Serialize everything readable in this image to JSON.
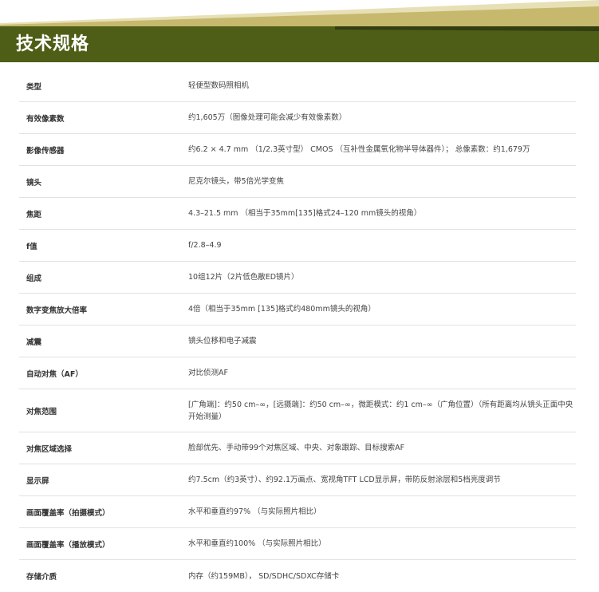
{
  "header": {
    "title": "技术规格",
    "colors": {
      "bar": "#4e5e17",
      "stripe_gold": "#c6b96e",
      "stripe_light": "#e7e0b6",
      "stripe_dark": "#323d10"
    }
  },
  "specs": [
    {
      "label": "类型",
      "value": "轻便型数码照相机"
    },
    {
      "label": "有效像素数",
      "value": "约1,605万（图像处理可能会减少有效像素数）"
    },
    {
      "label": "影像传感器",
      "value": "约6.2 × 4.7 mm （1/2.3英寸型） CMOS （互补性金属氧化物半导体器件）； 总像素数：约1,679万"
    },
    {
      "label": "镜头",
      "value": "尼克尔镜头，带5倍光学变焦"
    },
    {
      "label": "焦距",
      "value": "4.3–21.5 mm （相当于35mm[135]格式24–120 mm镜头的视角）"
    },
    {
      "label": "f值",
      "value": "f/2.8–4.9"
    },
    {
      "label": "组成",
      "value": "10组12片（2片低色散ED镜片）"
    },
    {
      "label": "数字变焦放大倍率",
      "value": "4倍（相当于35mm [135]格式约480mm镜头的视角）"
    },
    {
      "label": "减震",
      "value": "镜头位移和电子减震"
    },
    {
      "label": "自动对焦（AF）",
      "value": "对比侦测AF"
    },
    {
      "label": "对焦范围",
      "value": "[广角端]：约50 cm–∞，[远摄端]：约50 cm–∞，微距模式：约1 cm–∞（广角位置）（所有距离均从镜头正面中央开始测量）"
    },
    {
      "label": "对焦区域选择",
      "value": "脸部优先、手动带99个对焦区域、中央、对象跟踪、目标搜索AF"
    },
    {
      "label": "显示屏",
      "value": "约7.5cm（约3英寸）、约92.1万画点、宽视角TFT LCD显示屏，带防反射涂层和5档亮度调节"
    },
    {
      "label": "画面覆盖率（拍摄模式）",
      "value": "水平和垂直约97% （与实际照片相比）"
    },
    {
      "label": "画面覆盖率（播放模式）",
      "value": "水平和垂直约100% （与实际照片相比）"
    },
    {
      "label": "存储介质",
      "value": "内存（约159MB）， SD/SDHC/SDXC存储卡"
    }
  ]
}
